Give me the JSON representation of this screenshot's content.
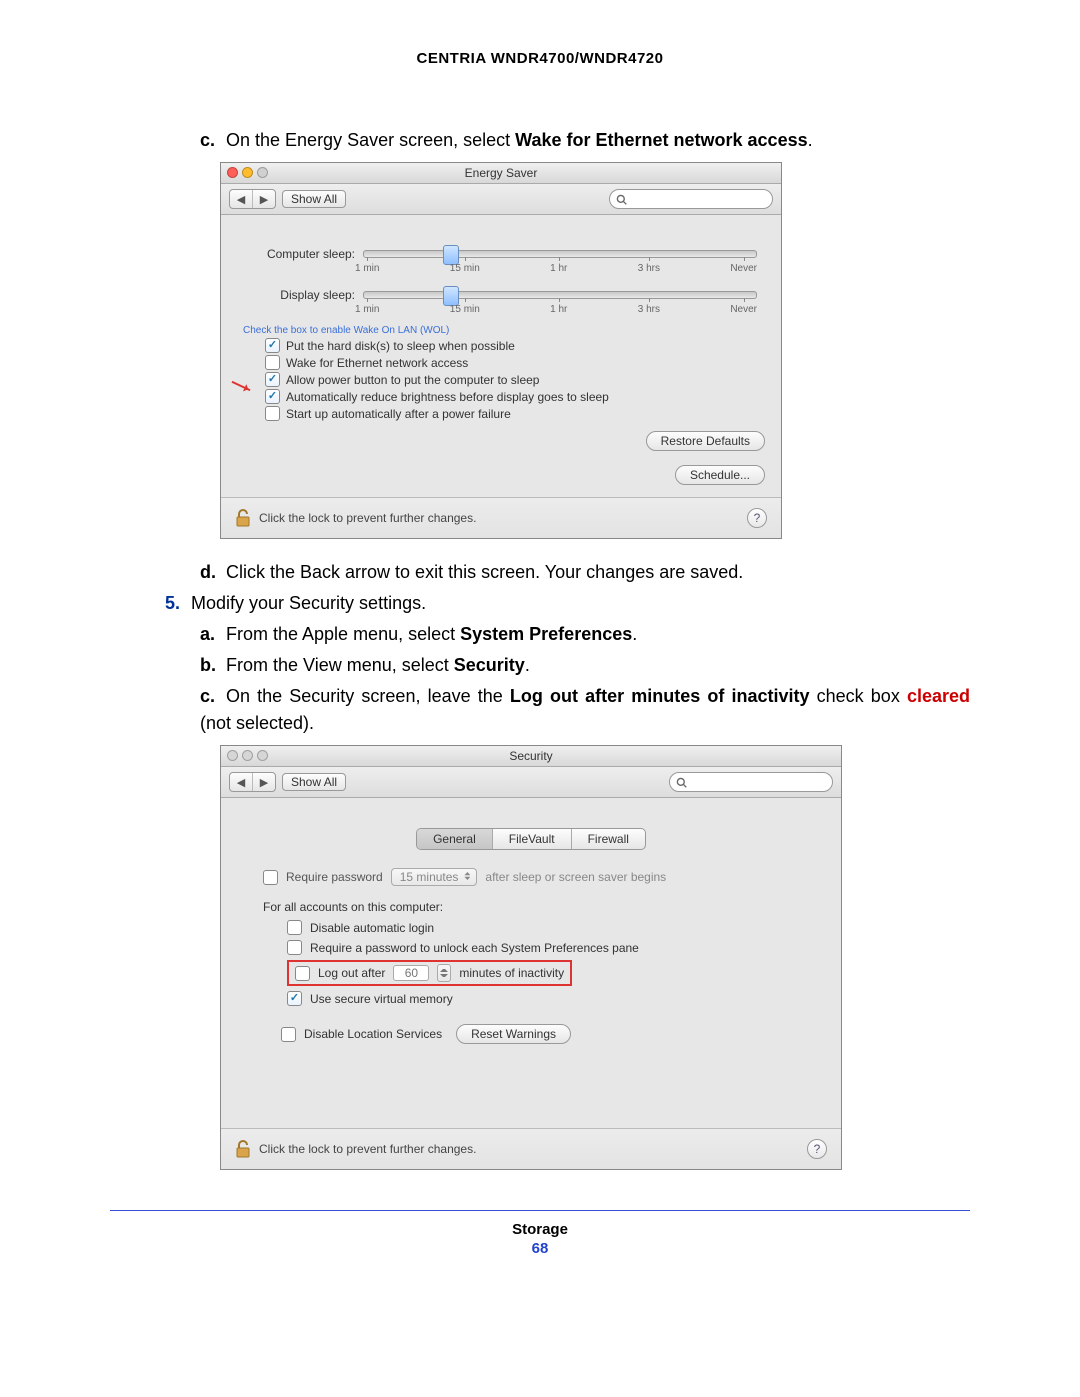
{
  "header": "CENTRIA WNDR4700/WNDR4720",
  "instr": {
    "c1_pre": "On the Energy Saver screen, select ",
    "c1_bold": "Wake for Ethernet network access",
    "d": "Click the Back arrow to exit this screen. Your changes are saved.",
    "step5": "Modify your Security settings.",
    "a_pre": "From the Apple menu, select ",
    "a_bold": "System Preferences",
    "b_pre": "From the View menu, select ",
    "b_bold": "Security",
    "c2_pre": "On the Security screen, leave the ",
    "c2_bold": "Log out after minutes of inactivity",
    "c2_mid": " check box ",
    "c2_red": "cleared",
    "c2_post": " (not selected)."
  },
  "energy": {
    "title": "Energy Saver",
    "showall": "Show All",
    "computer_sleep": "Computer sleep:",
    "display_sleep": "Display sleep:",
    "ticks": {
      "t1": "1 min",
      "t15": "15 min",
      "t1h": "1 hr",
      "t3h": "3 hrs",
      "tn": "Never"
    },
    "wol_hint": "Check the box to enable Wake On LAN (WOL)",
    "opts": {
      "hd": "Put the hard disk(s) to sleep when possible",
      "wake": "Wake for Ethernet network access",
      "power": "Allow power button to put the computer to sleep",
      "bright": "Automatically reduce brightness before display goes to sleep",
      "startup": "Start up automatically after a power failure"
    },
    "restore": "Restore Defaults",
    "schedule": "Schedule...",
    "lock": "Click the lock to prevent further changes."
  },
  "security": {
    "title": "Security",
    "showall": "Show All",
    "tabs": {
      "general": "General",
      "filevault": "FileVault",
      "firewall": "Firewall"
    },
    "req_pw": "Require password",
    "req_pw_sel": "15 minutes",
    "req_pw_after": "after sleep or screen saver begins",
    "all_accounts": "For all accounts on this computer:",
    "opts": {
      "disable_auto": "Disable automatic login",
      "req_pw_pane": "Require a password to unlock each System Preferences pane",
      "logout_pre": "Log out after",
      "logout_val": "60",
      "logout_post": "minutes of inactivity",
      "secure_vm": "Use secure virtual memory"
    },
    "disable_loc": "Disable Location Services",
    "reset_warn": "Reset Warnings",
    "lock": "Click the lock to prevent further changes."
  },
  "footer": {
    "label": "Storage",
    "page": "68"
  }
}
